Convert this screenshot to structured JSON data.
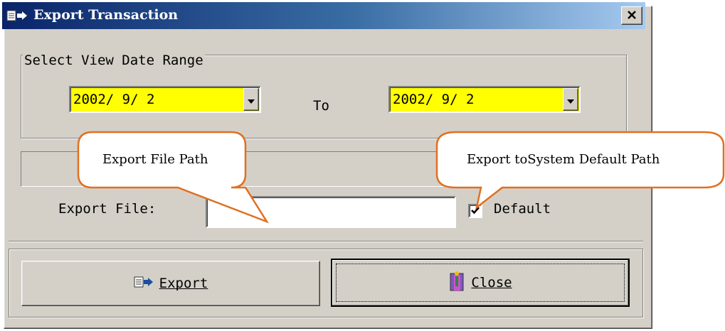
{
  "window": {
    "title": "Export Transaction",
    "close_glyph": "✕"
  },
  "date_range": {
    "group_label": "Select View Date Range",
    "from_value": "2002/ 9/ 2",
    "to_label": "To",
    "to_value": "2002/ 9/ 2",
    "highlight_color": "#ffff00"
  },
  "export_file": {
    "label": "Export File:",
    "value": "",
    "default_label": "Default",
    "default_checked": true
  },
  "buttons": {
    "export_label": "Export",
    "close_label": "Close"
  },
  "callouts": {
    "file_path": "Export File Path",
    "default_path": "Export toSystem Default Path",
    "border_color": "#e07020"
  },
  "icons": [
    "export-icon",
    "close-door-icon",
    "dropdown-arrow-icon",
    "checkmark-icon"
  ]
}
